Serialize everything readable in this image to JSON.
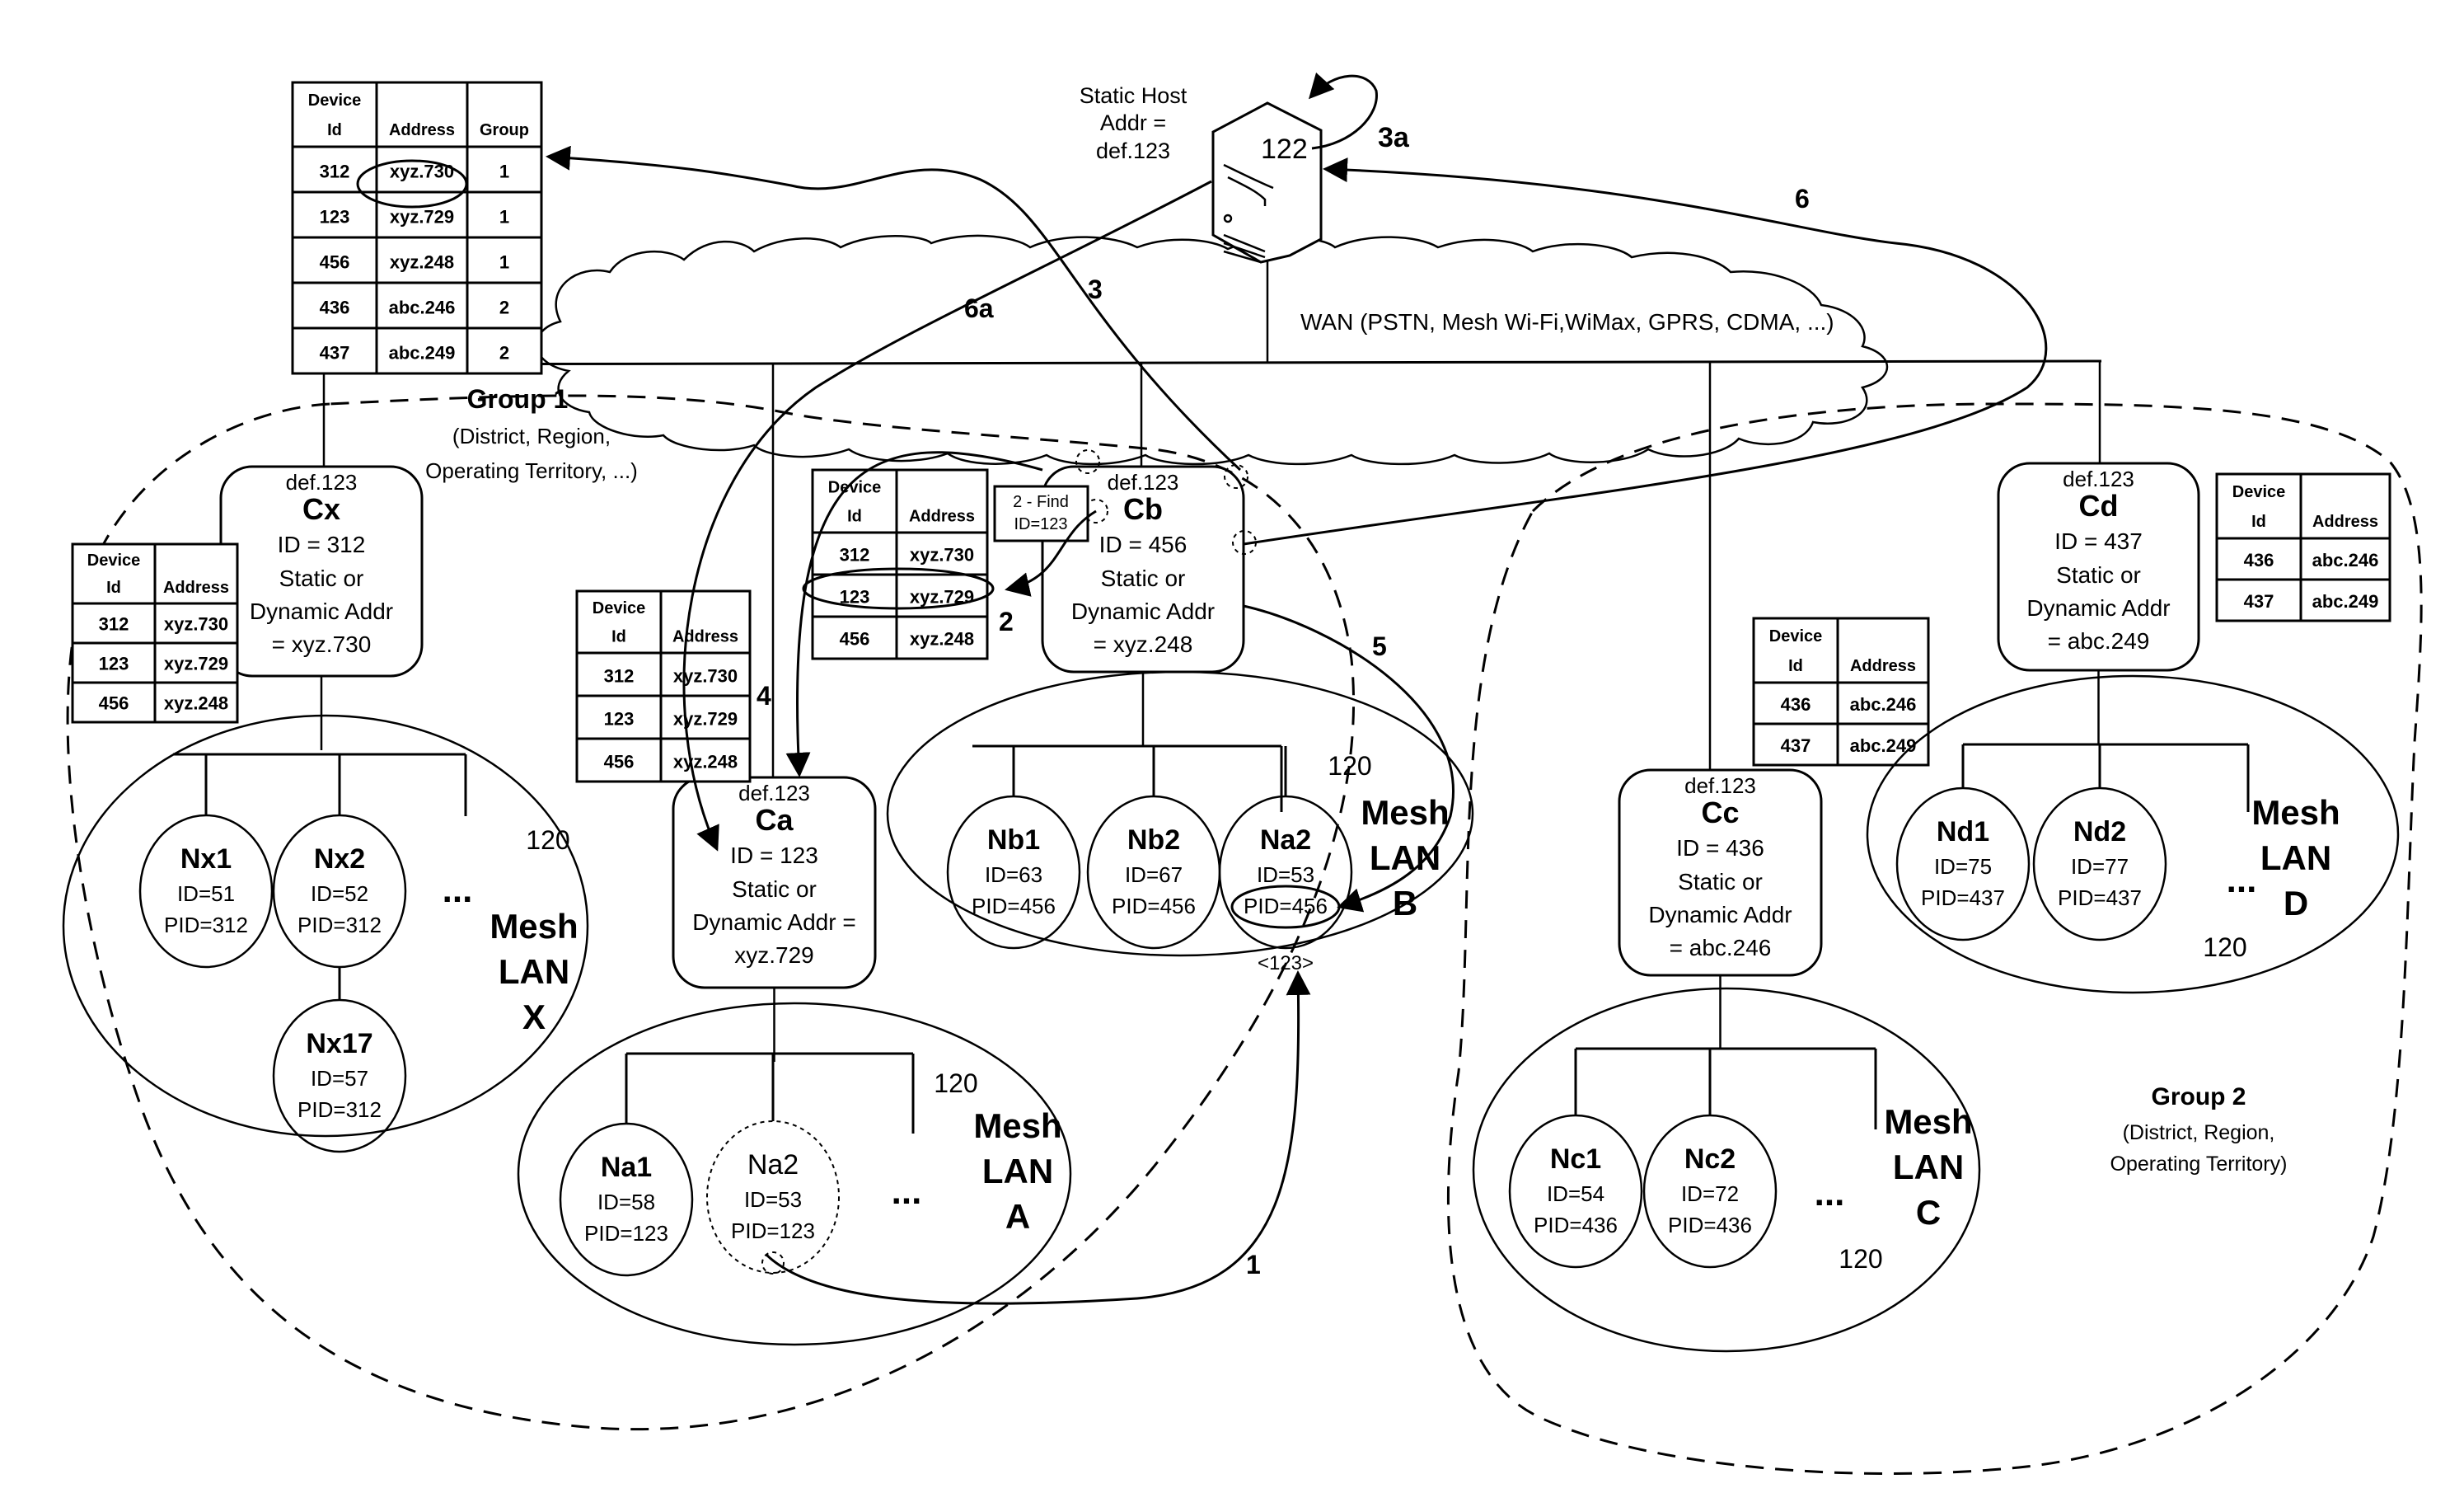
{
  "server": {
    "label_lines": [
      "Static Host",
      "Addr =",
      "def.123"
    ],
    "ref": "122",
    "loop_label": "3a"
  },
  "wan": {
    "label": "WAN (PSTN, Mesh Wi-Fi,WiMax, GPRS, CDMA, ...)"
  },
  "master_table": {
    "headers": [
      "Device Id",
      "Address",
      "Group"
    ],
    "rows": [
      [
        "312",
        "xyz.730",
        "1"
      ],
      [
        "123",
        "xyz.729",
        "1"
      ],
      [
        "456",
        "xyz.248",
        "1"
      ],
      [
        "436",
        "abc.246",
        "2"
      ],
      [
        "437",
        "abc.249",
        "2"
      ]
    ],
    "highlighted_row": 1
  },
  "groups": [
    {
      "title": "Group 1",
      "subtitle_lines": [
        "(District, Region,",
        "Operating Territory, ...)"
      ]
    },
    {
      "title": "Group 2",
      "subtitle_lines": [
        "(District, Region,",
        "Operating Territory)"
      ]
    }
  ],
  "controllers": [
    {
      "key": "cx",
      "host": "def.123",
      "name": "Cx",
      "id_line": "ID = 312",
      "lines": [
        "Static or",
        "Dynamic Addr",
        "= xyz.730"
      ]
    },
    {
      "key": "cb",
      "host": "def.123",
      "name": "Cb",
      "id_line": "ID = 456",
      "lines": [
        "Static or",
        "Dynamic Addr",
        "= xyz.248"
      ]
    },
    {
      "key": "ca",
      "host": "def.123",
      "name": "Ca",
      "id_line": "ID = 123",
      "lines": [
        "Static or",
        "Dynamic Addr =",
        "xyz.729"
      ]
    },
    {
      "key": "cc",
      "host": "def.123",
      "name": "Cc",
      "id_line": "ID = 436",
      "lines": [
        "Static or",
        "Dynamic Addr",
        "= abc.246"
      ]
    },
    {
      "key": "cd",
      "host": "def.123",
      "name": "Cd",
      "id_line": "ID = 437",
      "lines": [
        "Static or",
        "Dynamic Addr",
        "= abc.249"
      ]
    }
  ],
  "local_tables": {
    "group1": {
      "headers": [
        "Device Id",
        "Address"
      ],
      "rows": [
        [
          "312",
          "xyz.730"
        ],
        [
          "123",
          "xyz.729"
        ],
        [
          "456",
          "xyz.248"
        ]
      ]
    },
    "group2": {
      "headers": [
        "Device Id",
        "Address"
      ],
      "rows": [
        [
          "436",
          "abc.246"
        ],
        [
          "437",
          "abc.249"
        ]
      ]
    }
  },
  "find_box": {
    "lines": [
      "2 - Find",
      "ID=123"
    ]
  },
  "mesh_lans": [
    {
      "key": "x",
      "name_lines": [
        "Mesh",
        "LAN",
        "X"
      ],
      "ref": "120",
      "nodes": [
        {
          "name": "Nx1",
          "id": "ID=51",
          "pid": "PID=312"
        },
        {
          "name": "Nx2",
          "id": "ID=52",
          "pid": "PID=312"
        },
        {
          "name": "Nx17",
          "id": "ID=57",
          "pid": "PID=312"
        }
      ]
    },
    {
      "key": "b",
      "name_lines": [
        "Mesh",
        "LAN",
        "B"
      ],
      "ref": "120",
      "nodes": [
        {
          "name": "Nb1",
          "id": "ID=63",
          "pid": "PID=456"
        },
        {
          "name": "Nb2",
          "id": "ID=67",
          "pid": "PID=456"
        },
        {
          "name": "Na2",
          "id": "ID=53",
          "pid": "PID=456",
          "note": "<123>"
        }
      ]
    },
    {
      "key": "a",
      "name_lines": [
        "Mesh",
        "LAN",
        "A"
      ],
      "ref": "120",
      "nodes": [
        {
          "name": "Na1",
          "id": "ID=58",
          "pid": "PID=123"
        },
        {
          "name": "Na2",
          "id": "ID=53",
          "pid": "PID=123",
          "ghost": true
        }
      ]
    },
    {
      "key": "c",
      "name_lines": [
        "Mesh",
        "LAN",
        "C"
      ],
      "ref": "120",
      "nodes": [
        {
          "name": "Nc1",
          "id": "ID=54",
          "pid": "PID=436"
        },
        {
          "name": "Nc2",
          "id": "ID=72",
          "pid": "PID=436"
        }
      ]
    },
    {
      "key": "d",
      "name_lines": [
        "Mesh",
        "LAN",
        "D"
      ],
      "ref": "120",
      "nodes": [
        {
          "name": "Nd1",
          "id": "ID=75",
          "pid": "PID=437"
        },
        {
          "name": "Nd2",
          "id": "ID=77",
          "pid": "PID=437"
        }
      ]
    }
  ],
  "ellipsis": "...",
  "steps": {
    "s1": "1",
    "s2": "2",
    "s3": "3",
    "s4": "4",
    "s5": "5",
    "s6": "6",
    "s6a": "6a"
  }
}
